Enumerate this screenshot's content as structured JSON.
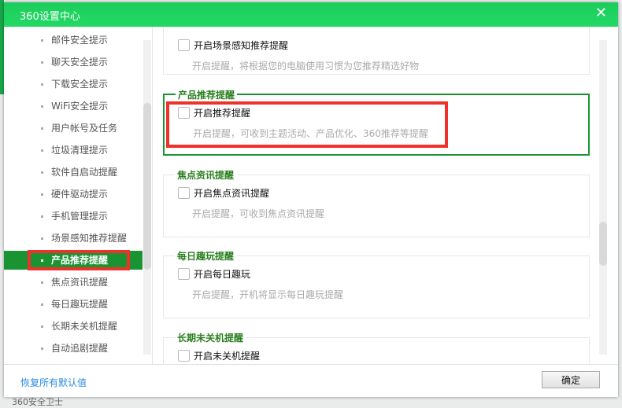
{
  "window": {
    "title": "360设置中心",
    "close_icon": "close-icon"
  },
  "sidebar": {
    "items": [
      {
        "label": "邮件安全提示"
      },
      {
        "label": "聊天安全提示"
      },
      {
        "label": "下载安全提示"
      },
      {
        "label": "WiFi安全提示"
      },
      {
        "label": "用户帐号及任务"
      },
      {
        "label": "垃圾清理提示"
      },
      {
        "label": "软件自启动提醒"
      },
      {
        "label": "硬件驱动提示"
      },
      {
        "label": "手机管理提示"
      },
      {
        "label": "场景感知推荐提醒"
      },
      {
        "label": "产品推荐提醒",
        "active": true
      },
      {
        "label": "焦点资讯提醒"
      },
      {
        "label": "每日趣玩提醒"
      },
      {
        "label": "长期未关机提醒"
      },
      {
        "label": "自动追剧提醒"
      }
    ]
  },
  "groups": [
    {
      "title": "",
      "checkbox": "开启场景感知推荐提醒",
      "desc": "开启提醒，将根据您的电脑使用习惯为您推荐精选好物",
      "checked": false
    },
    {
      "title": "产品推荐提醒",
      "checkbox": "开启推荐提醒",
      "desc": "开启提醒，可收到主题活动、产品优化、360推荐等提醒",
      "checked": false
    },
    {
      "title": "焦点资讯提醒",
      "checkbox": "开启焦点资讯提醒",
      "desc": "开启提醒，可收到焦点资讯提醒",
      "checked": false
    },
    {
      "title": "每日趣玩提醒",
      "checkbox": "开启每日趣玩",
      "desc": "开启提醒，开机将显示每日趣玩提醒",
      "checked": false
    },
    {
      "title": "长期未关机提醒",
      "checkbox": "开启未关机提醒",
      "desc": "",
      "checked": false
    }
  ],
  "footer": {
    "restore_label": "恢复所有默认值",
    "ok_label": "确定"
  },
  "background": {
    "bottom_text": "360安全卫士"
  },
  "colors": {
    "title_bar": "#1fd35f",
    "accent": "#1a9332",
    "highlight": "#f0302a",
    "link": "#2a8be0"
  }
}
